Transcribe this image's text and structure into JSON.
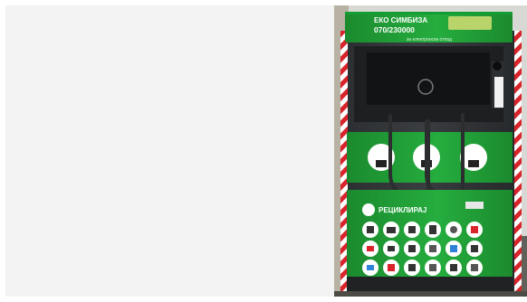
{
  "image": {
    "kind": "photo",
    "subject": "E-waste recycling container",
    "brand_text": "РЕЦИКЛИРАЈ",
    "phone_text": "070/230000",
    "header_text": "ЕКО СИМБИЗА",
    "small_label": "за електронски отпад",
    "bin_labels": [
      "Батерии",
      "Сијалици",
      "Мобилни"
    ],
    "colors": {
      "body": "#333638",
      "green": "#22a93a",
      "green_dark": "#1b8a2e",
      "stripe_red": "#d8242a",
      "stripe_white": "#ffffff"
    }
  }
}
